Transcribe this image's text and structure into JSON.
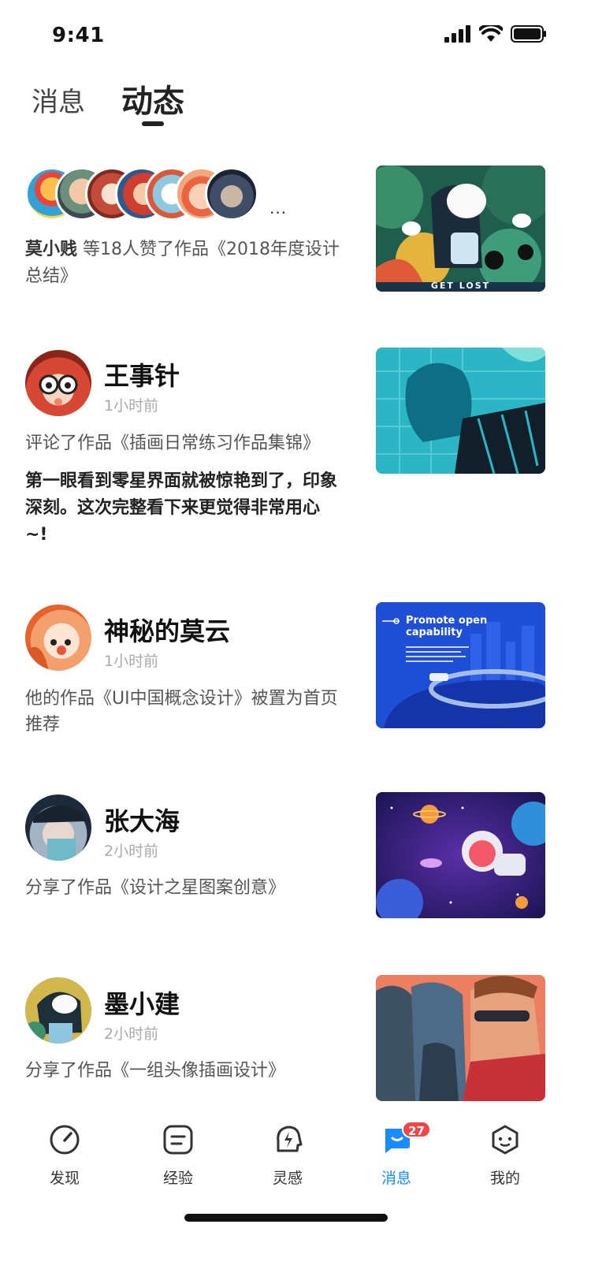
{
  "status_bar": {
    "time": "9:41"
  },
  "tabs": {
    "inactive_label": "消息",
    "active_label": "动态"
  },
  "feed": {
    "like_item": {
      "user": "莫小贱",
      "text": " 等18人赞了作品《2018年度设计总结》",
      "more": "···",
      "thumb_caption": "GET LOST"
    },
    "items": [
      {
        "name": "王事针",
        "time": "1小时前",
        "desc": "评论了作品《插画日常练习作品集锦》",
        "comment": "第一眼看到零星界面就被惊艳到了，印象深刻。这次完整看下来更觉得非常用心~!"
      },
      {
        "name": "神秘的莫云",
        "time": "1小时前",
        "desc": "他的作品《UI中国概念设计》被置为首页推荐",
        "thumb_title": "Promote open capability"
      },
      {
        "name": "张大海",
        "time": "2小时前",
        "desc": "分享了作品《设计之星图案创意》"
      },
      {
        "name": "墨小建",
        "time": "2小时前",
        "desc": "分享了作品《一组头像插画设计》"
      }
    ]
  },
  "tabbar": {
    "items": [
      {
        "label": "发现",
        "icon": "compass-icon"
      },
      {
        "label": "经验",
        "icon": "document-icon"
      },
      {
        "label": "灵感",
        "icon": "lightning-head-icon"
      },
      {
        "label": "消息",
        "icon": "message-icon",
        "badge": "27"
      },
      {
        "label": "我的",
        "icon": "face-icon"
      }
    ],
    "accent": "#1a8cff",
    "badge_color": "#f04848"
  }
}
